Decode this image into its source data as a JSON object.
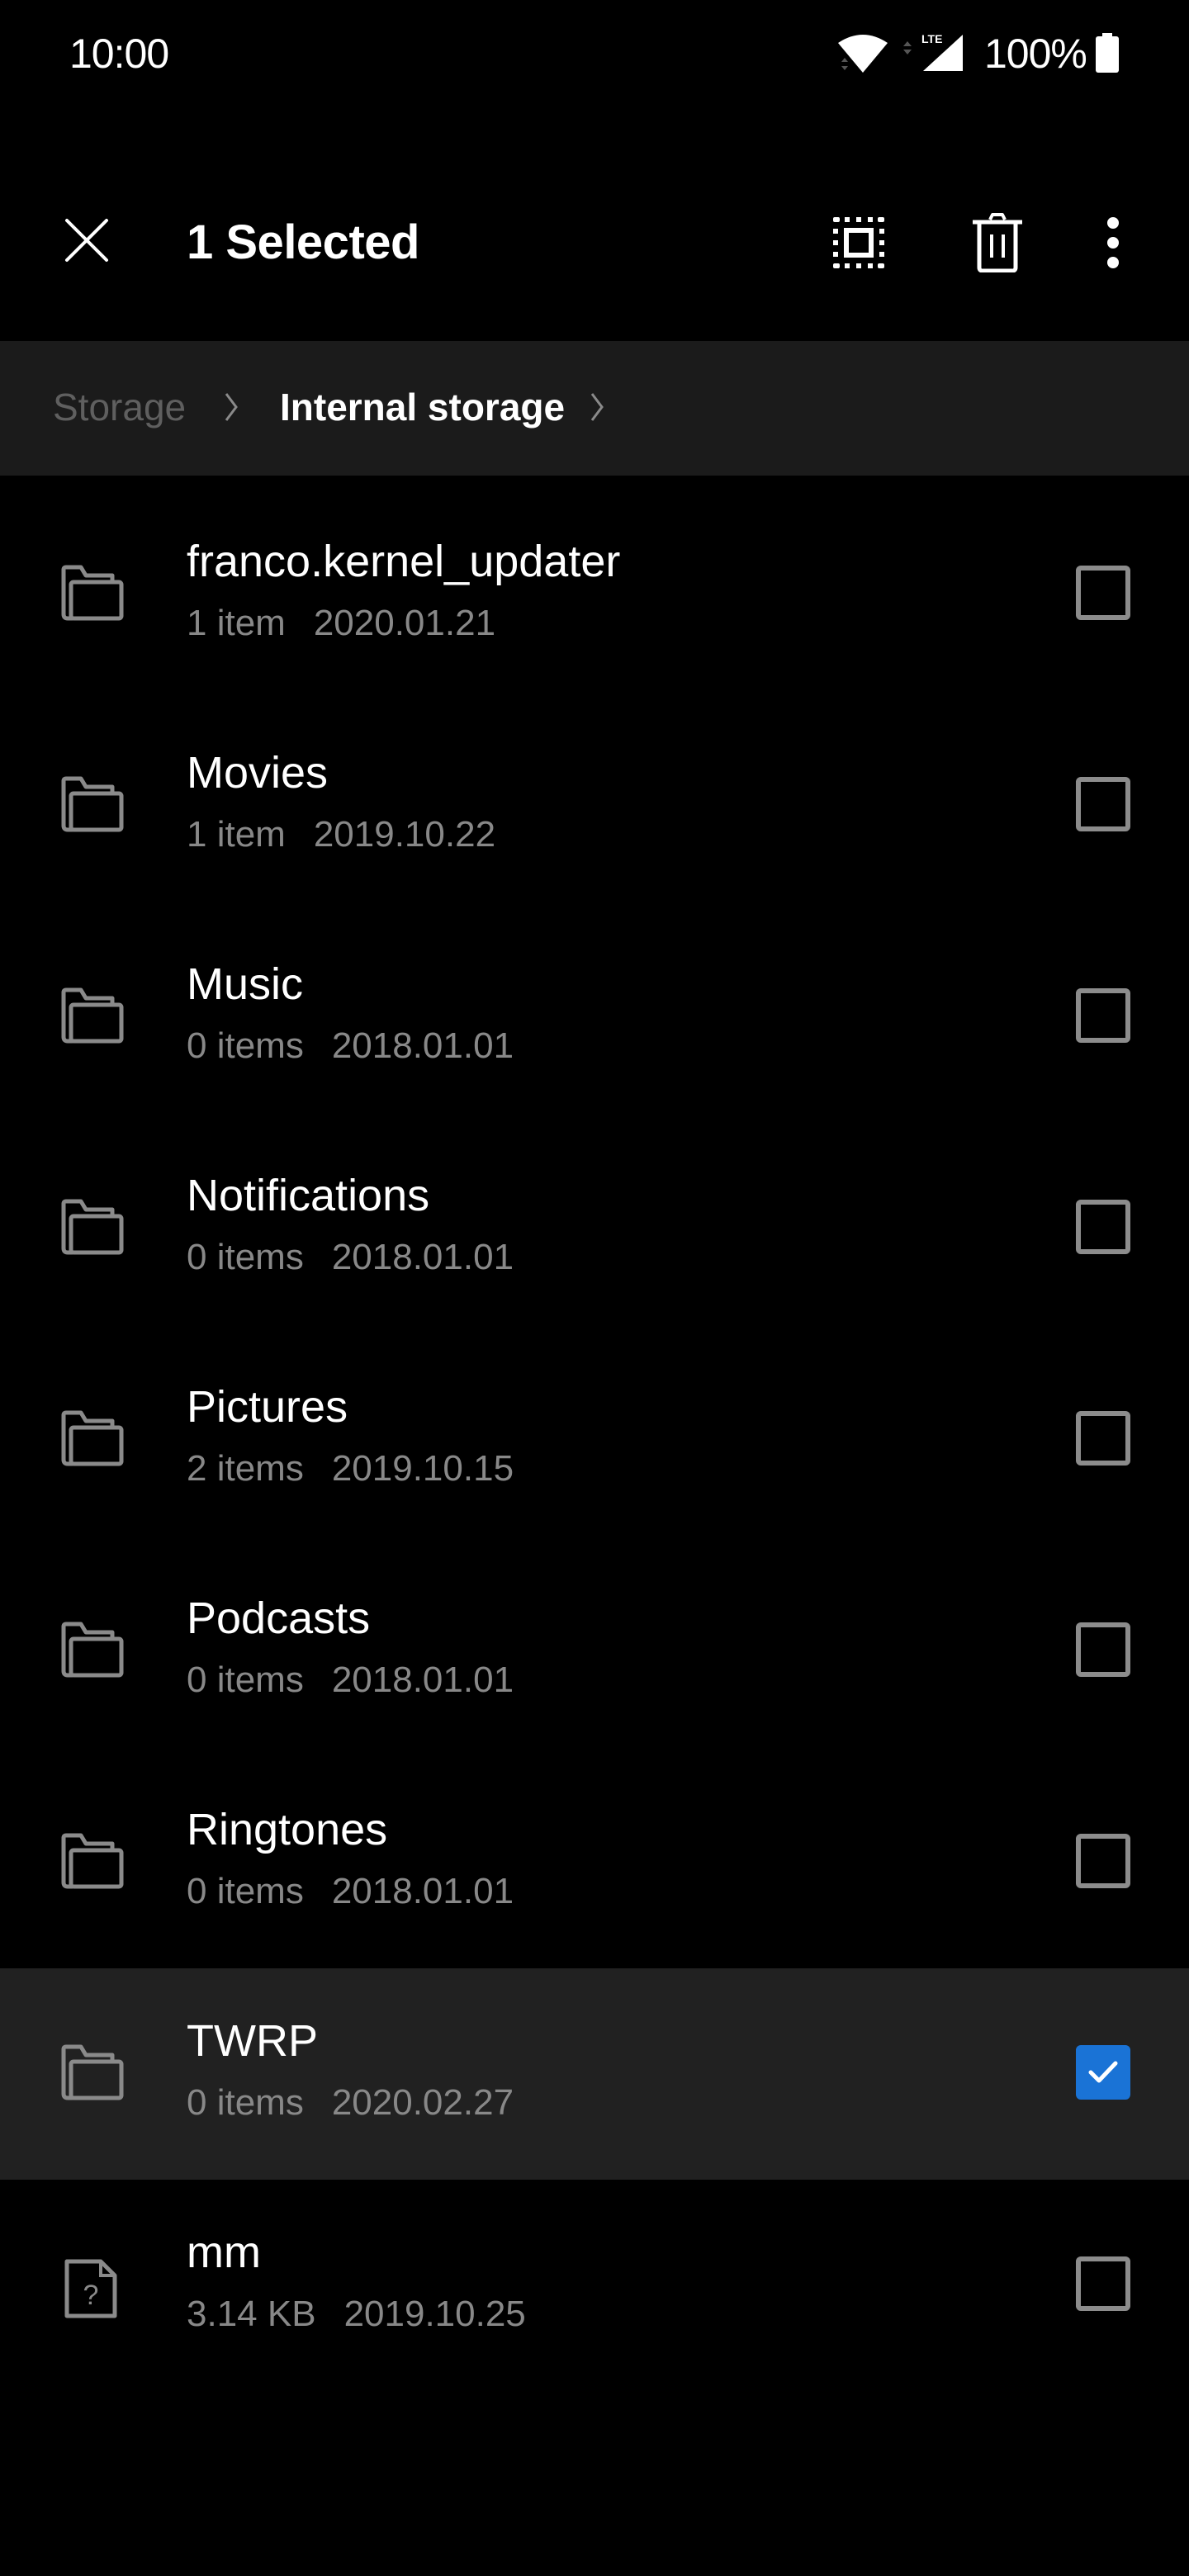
{
  "status_bar": {
    "time": "10:00",
    "battery_percent": "100%",
    "network_label": "LTE",
    "icons": [
      "wifi-icon",
      "signal-icon",
      "battery-icon"
    ]
  },
  "action_bar": {
    "close_icon": "close-icon",
    "title": "1 Selected",
    "actions": [
      {
        "name": "select-all",
        "icon": "select-all-icon"
      },
      {
        "name": "delete",
        "icon": "trash-icon"
      },
      {
        "name": "more-options",
        "icon": "more-vert-icon"
      }
    ]
  },
  "breadcrumb": {
    "items": [
      {
        "label": "Storage",
        "active": false
      },
      {
        "label": "Internal storage",
        "active": true
      }
    ],
    "separator_icon": "chevron-right-icon"
  },
  "files": [
    {
      "name": "franco.kernel_updater",
      "meta": "1 item",
      "date": "2020.01.21",
      "type": "folder",
      "selected": false
    },
    {
      "name": "Movies",
      "meta": "1 item",
      "date": "2019.10.22",
      "type": "folder",
      "selected": false
    },
    {
      "name": "Music",
      "meta": "0 items",
      "date": "2018.01.01",
      "type": "folder",
      "selected": false
    },
    {
      "name": "Notifications",
      "meta": "0 items",
      "date": "2018.01.01",
      "type": "folder",
      "selected": false
    },
    {
      "name": "Pictures",
      "meta": "2 items",
      "date": "2019.10.15",
      "type": "folder",
      "selected": false
    },
    {
      "name": "Podcasts",
      "meta": "0 items",
      "date": "2018.01.01",
      "type": "folder",
      "selected": false
    },
    {
      "name": "Ringtones",
      "meta": "0 items",
      "date": "2018.01.01",
      "type": "folder",
      "selected": false
    },
    {
      "name": "TWRP",
      "meta": "0 items",
      "date": "2020.02.27",
      "type": "folder",
      "selected": true
    },
    {
      "name": "mm",
      "meta": "3.14 KB",
      "date": "2019.10.25",
      "type": "unknown-file",
      "selected": false
    }
  ],
  "colors": {
    "background": "#000000",
    "breadcrumb_bg": "#1b1b1b",
    "selected_row_bg": "#212121",
    "accent": "#1a73d6",
    "secondary_text": "#888888",
    "inactive_crumb": "#5f5f5f"
  }
}
